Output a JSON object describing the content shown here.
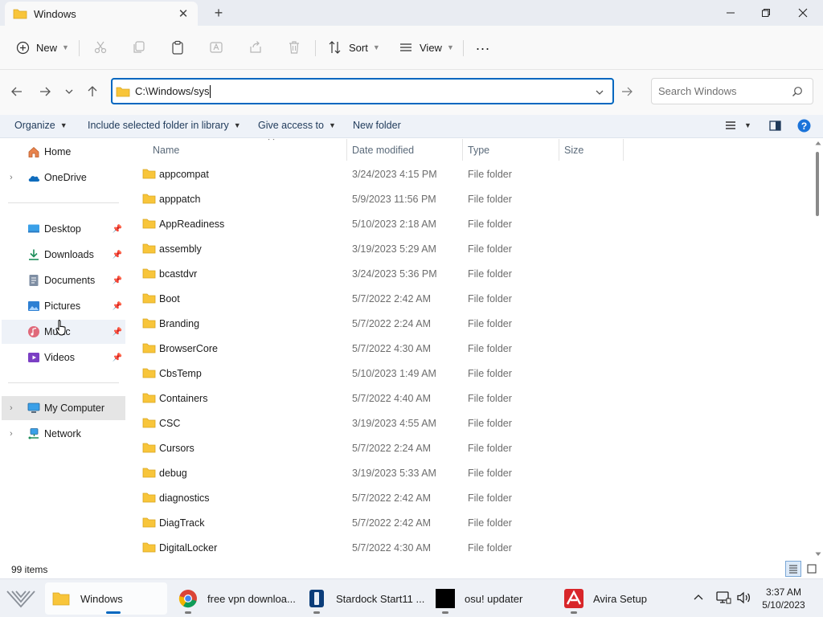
{
  "window": {
    "tab_title": "Windows",
    "new_tab": "+"
  },
  "command_bar": {
    "new_label": "New",
    "sort_label": "Sort",
    "view_label": "View",
    "more_label": "..."
  },
  "address_bar": {
    "path": "C:\\Windows/sys"
  },
  "search": {
    "placeholder": "Search Windows"
  },
  "toolbar": {
    "organize": "Organize",
    "include_library": "Include selected folder in library",
    "give_access": "Give access to",
    "new_folder": "New folder"
  },
  "nav": {
    "home": "Home",
    "onedrive": "OneDrive",
    "desktop": "Desktop",
    "downloads": "Downloads",
    "documents": "Documents",
    "pictures": "Pictures",
    "music": "Music",
    "videos": "Videos",
    "my_computer": "My Computer",
    "network": "Network"
  },
  "columns": {
    "name": "Name",
    "date_modified": "Date modified",
    "type": "Type",
    "size": "Size"
  },
  "files": [
    {
      "name": "appcompat",
      "date": "3/24/2023 4:15 PM",
      "type": "File folder"
    },
    {
      "name": "apppatch",
      "date": "5/9/2023 11:56 PM",
      "type": "File folder"
    },
    {
      "name": "AppReadiness",
      "date": "5/10/2023 2:18 AM",
      "type": "File folder"
    },
    {
      "name": "assembly",
      "date": "3/19/2023 5:29 AM",
      "type": "File folder"
    },
    {
      "name": "bcastdvr",
      "date": "3/24/2023 5:36 PM",
      "type": "File folder"
    },
    {
      "name": "Boot",
      "date": "5/7/2022 2:42 AM",
      "type": "File folder"
    },
    {
      "name": "Branding",
      "date": "5/7/2022 2:24 AM",
      "type": "File folder"
    },
    {
      "name": "BrowserCore",
      "date": "5/7/2022 4:30 AM",
      "type": "File folder"
    },
    {
      "name": "CbsTemp",
      "date": "5/10/2023 1:49 AM",
      "type": "File folder"
    },
    {
      "name": "Containers",
      "date": "5/7/2022 4:40 AM",
      "type": "File folder"
    },
    {
      "name": "CSC",
      "date": "3/19/2023 4:55 AM",
      "type": "File folder"
    },
    {
      "name": "Cursors",
      "date": "5/7/2022 2:24 AM",
      "type": "File folder"
    },
    {
      "name": "debug",
      "date": "3/19/2023 5:33 AM",
      "type": "File folder"
    },
    {
      "name": "diagnostics",
      "date": "5/7/2022 2:42 AM",
      "type": "File folder"
    },
    {
      "name": "DiagTrack",
      "date": "5/7/2022 2:42 AM",
      "type": "File folder"
    },
    {
      "name": "DigitalLocker",
      "date": "5/7/2022 4:30 AM",
      "type": "File folder"
    }
  ],
  "status": {
    "item_count": "99 items"
  },
  "taskbar": {
    "explorer": "Windows",
    "chrome": "free vpn downloa...",
    "stardock": "Stardock Start11 ...",
    "osu": "osu! updater",
    "avira": "Avira Setup",
    "time": "3:37 AM",
    "date": "5/10/2023"
  },
  "colors": {
    "accent": "#0067c0",
    "folder_yellow": "#f8c53a",
    "toolbar_bg": "#eef2f8"
  }
}
